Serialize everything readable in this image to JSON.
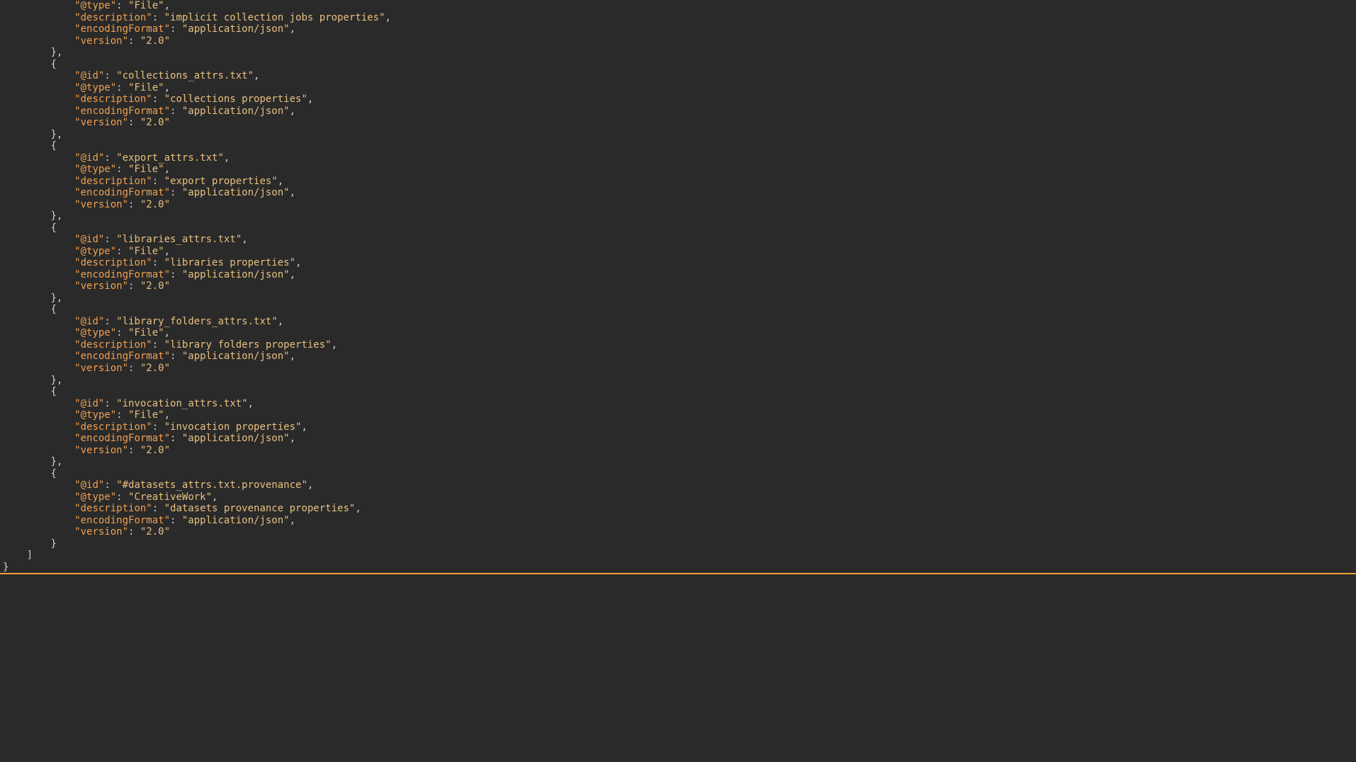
{
  "indent": {
    "l1": "    ",
    "l2": "        ",
    "l3": "            "
  },
  "keys": {
    "id": "@id",
    "type": "@type",
    "description": "description",
    "encodingFormat": "encodingFormat",
    "version": "version"
  },
  "common": {
    "typeFile": "File",
    "typeCreativeWork": "CreativeWork",
    "encoding": "application/json",
    "version": "2.0"
  },
  "partial": {
    "id_trailing_comma": ",",
    "type_value": "File",
    "description_value": "implicit collection jobs properties",
    "encoding_value": "application/json",
    "version_value": "2.0"
  },
  "entries": [
    {
      "id": "collections_attrs.txt",
      "type": "File",
      "description": "collections properties",
      "encodingFormat": "application/json",
      "version": "2.0",
      "trailingComma": true
    },
    {
      "id": "export_attrs.txt",
      "type": "File",
      "description": "export properties",
      "encodingFormat": "application/json",
      "version": "2.0",
      "trailingComma": true
    },
    {
      "id": "libraries_attrs.txt",
      "type": "File",
      "description": "libraries properties",
      "encodingFormat": "application/json",
      "version": "2.0",
      "trailingComma": true
    },
    {
      "id": "library_folders_attrs.txt",
      "type": "File",
      "description": "library folders properties",
      "encodingFormat": "application/json",
      "version": "2.0",
      "trailingComma": true
    },
    {
      "id": "invocation_attrs.txt",
      "type": "File",
      "description": "invocation properties",
      "encodingFormat": "application/json",
      "version": "2.0",
      "trailingComma": true
    },
    {
      "id": "#datasets_attrs.txt.provenance",
      "type": "CreativeWork",
      "description": "datasets provenance properties",
      "encodingFormat": "application/json",
      "version": "2.0",
      "trailingComma": false
    }
  ],
  "tail": {
    "closeArray": "]",
    "closeObj": "}"
  }
}
